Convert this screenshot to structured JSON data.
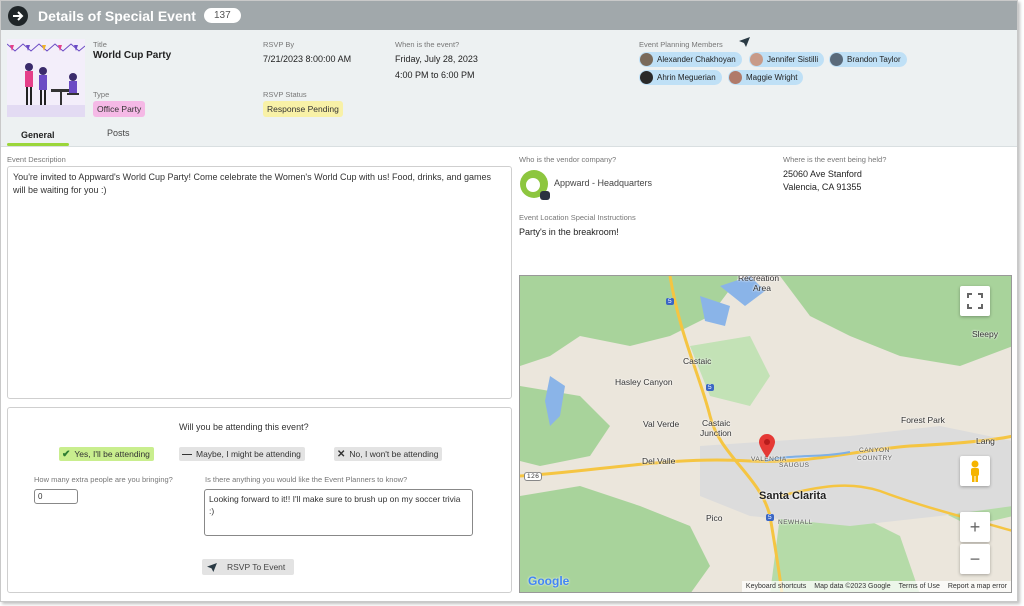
{
  "window": {
    "title": "Details of Special Event",
    "count": "137"
  },
  "event": {
    "title_label": "Title",
    "title": "World Cup Party",
    "rsvp_by_label": "RSVP By",
    "rsvp_by": "7/21/2023 8:00:00 AM",
    "when_label": "When is the event?",
    "when_date": "Friday, July 28, 2023",
    "when_time": "4:00 PM to 6:00 PM",
    "type_label": "Type",
    "type": "Office Party",
    "rsvp_status_label": "RSVP Status",
    "rsvp_status": "Response Pending",
    "members_label": "Event Planning Members",
    "members": [
      {
        "name": "Alexander Chakhoyan"
      },
      {
        "name": "Jennifer Sistilli"
      },
      {
        "name": "Brandon Taylor"
      },
      {
        "name": "Ahrin Meguerian"
      },
      {
        "name": "Maggie Wright"
      }
    ]
  },
  "tabs": [
    {
      "label": "General"
    },
    {
      "label": "Posts"
    }
  ],
  "description": {
    "label": "Event Description",
    "text": "You're invited to Appward's World Cup Party! Come celebrate the Women's World Cup with us! Food, drinks, and games will be waiting for you :)"
  },
  "vendor": {
    "label": "Who is the vendor company?",
    "name": "Appward - Headquarters"
  },
  "location": {
    "label": "Where is the event being held?",
    "line1": "25060 Ave Stanford",
    "line2": "Valencia, CA 91355",
    "instructions_label": "Event Location Special Instructions",
    "instructions": "Party's in the breakroom!"
  },
  "rsvp": {
    "question": "Will you be attending this event?",
    "yes": "Yes, I'll be attending",
    "maybe": "Maybe, I might be attending",
    "no": "No, I won't be attending",
    "extra_label": "How many extra people are you bringing?",
    "extra_value": "0",
    "notes_label": "Is there anything you would like the Event Planners to know?",
    "notes_value": "Looking forward to it!! I'll make sure to brush up on my soccer trivia :)",
    "button": "RSVP To Event"
  },
  "map": {
    "places": {
      "recreation": "Recreation",
      "area": "Area",
      "castaic": "Castaic",
      "hasley": "Hasley Canyon",
      "sleepy": "Sleepy",
      "valverde": "Val Verde",
      "castaic_junction": "Castaic",
      "junction": "Junction",
      "forest_park": "Forest Park",
      "lang": "Lang",
      "del_valle": "Del Valle",
      "valencia": "VALENCIA",
      "saugus": "SAUGUS",
      "canyon_country": "CANYON",
      "country": "COUNTRY",
      "santa_clarita": "Santa Clarita",
      "pico": "Pico",
      "newhall": "NEWHALL",
      "r126": "126",
      "r5a": "5",
      "r5b": "5",
      "r5c": "5"
    },
    "google": "Google",
    "footer": {
      "shortcuts": "Keyboard shortcuts",
      "data": "Map data ©2023 Google",
      "terms": "Terms of Use",
      "report": "Report a map error"
    }
  },
  "colors": {
    "accent_green": "#9bd63a",
    "yes_bg": "#c9ee8e",
    "type_tag": "#f5b9e6",
    "status_tag": "#f8f1a7",
    "member_chip": "#bfe0f6"
  }
}
